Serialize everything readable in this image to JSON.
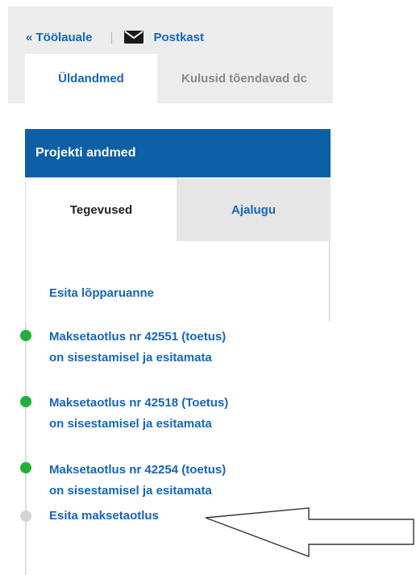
{
  "nav": {
    "back_link": "« Töölauale",
    "separator": "|",
    "mailbox_label": "Postkast",
    "mailbox_icon": "envelope-icon"
  },
  "tabs": [
    {
      "label": "Üldandmed",
      "active": true
    },
    {
      "label": "Kulusid tõendavad dc",
      "active": false
    }
  ],
  "panel": {
    "title": "Projekti andmed",
    "subtabs": [
      {
        "label": "Tegevused",
        "active": true
      },
      {
        "label": "Ajalugu",
        "active": false
      }
    ],
    "items": [
      {
        "text": "Esita lõpparuanne",
        "status": "none"
      },
      {
        "line1": "Maksetaotlus nr 42551 (toetus)",
        "line2": "on sisestamisel ja esitamata",
        "status": "green"
      },
      {
        "line1": "Maksetaotlus nr 42518 (Toetus)",
        "line2": "on sisestamisel ja esitamata",
        "status": "green"
      },
      {
        "line1": "Maksetaotlus nr 42254 (toetus)",
        "line2": "on sisestamisel ja esitamata",
        "status": "green"
      },
      {
        "text": "Esita maksetaotlus",
        "status": "grey"
      }
    ]
  },
  "colors": {
    "brand_blue": "#0d5fa6",
    "link_blue": "#1565c0",
    "status_green": "#21b03b",
    "status_grey": "#d5d5d5"
  },
  "annotation": {
    "type": "arrow-pointing-left",
    "target": "Esita maksetaotlus"
  }
}
